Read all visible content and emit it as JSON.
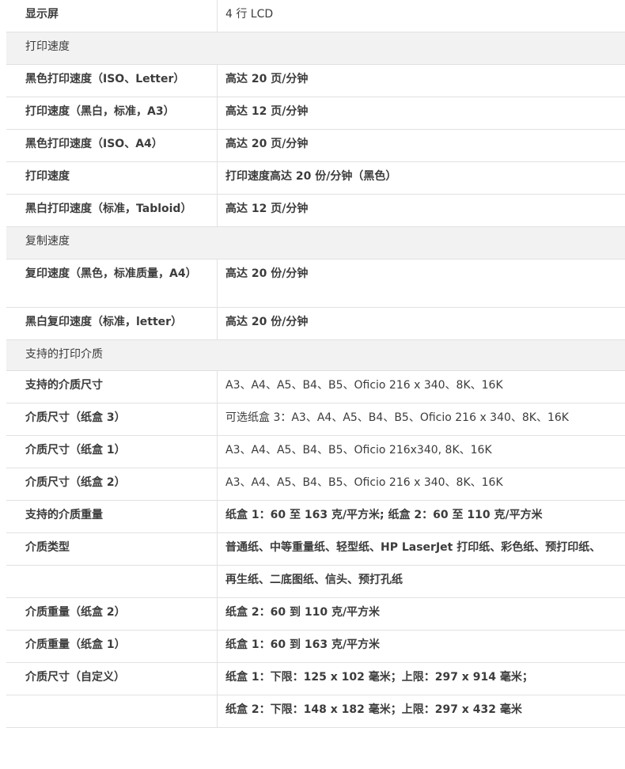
{
  "rows": [
    {
      "type": "spec",
      "label": "显示屏",
      "value": "4 行 LCD",
      "bold": false
    },
    {
      "type": "section",
      "title": "打印速度"
    },
    {
      "type": "spec",
      "label": "黑色打印速度（ISO、Letter）",
      "value": "高达 20 页/分钟",
      "bold": true
    },
    {
      "type": "spec",
      "label": "打印速度（黑白，标准，A3）",
      "value": "高达 12 页/分钟",
      "bold": true
    },
    {
      "type": "spec",
      "label": "黑色打印速度（ISO、A4）",
      "value": "高达 20 页/分钟",
      "bold": true
    },
    {
      "type": "spec",
      "label": "打印速度",
      "value": "打印速度高达 20 份/分钟（黑色）",
      "bold": true
    },
    {
      "type": "spec",
      "label": "黑白打印速度（标准，Tabloid）",
      "value": "高达 12 页/分钟",
      "bold": true
    },
    {
      "type": "section",
      "title": "复制速度"
    },
    {
      "type": "spec",
      "label": "复印速度（黑色，标准质量，A4）",
      "value": "高达 20 份/分钟",
      "bold": true,
      "tall": true
    },
    {
      "type": "spec",
      "label": "黑白复印速度（标准，letter）",
      "value": "高达 20 份/分钟",
      "bold": true
    },
    {
      "type": "section",
      "title": "支持的打印介质"
    },
    {
      "type": "spec",
      "label": "支持的介质尺寸",
      "value": "A3、A4、A5、B4、B5、Oficio 216 x 340、8K、16K",
      "bold": false
    },
    {
      "type": "spec",
      "label": "介质尺寸（纸盒 3）",
      "value": "可选纸盒 3：A3、A4、A5、B4、B5、Oficio 216 x 340、8K、16K",
      "bold": false
    },
    {
      "type": "spec",
      "label": "介质尺寸（纸盒 1）",
      "value": "A3、A4、A5、B4、B5、Oficio 216x340, 8K、16K",
      "bold": false
    },
    {
      "type": "spec",
      "label": "介质尺寸（纸盒 2）",
      "value": "A3、A4、A5、B4、B5、Oficio 216 x 340、8K、16K",
      "bold": false
    },
    {
      "type": "spec",
      "label": "支持的介质重量",
      "value": "纸盒 1：60 至 163 克/平方米; 纸盒 2：60 至 110 克/平方米",
      "bold": true
    },
    {
      "type": "spec",
      "label": "介质类型",
      "value": "普通纸、中等重量纸、轻型纸、HP LaserJet 打印纸、彩色纸、预打印纸、",
      "bold": true
    },
    {
      "type": "spec",
      "label": "",
      "value": "再生纸、二底图纸、信头、预打孔纸",
      "bold": true
    },
    {
      "type": "spec",
      "label": "介质重量（纸盒 2）",
      "value": "纸盒 2：60 到 110 克/平方米",
      "bold": true
    },
    {
      "type": "spec",
      "label": "介质重量（纸盒 1）",
      "value": "纸盒 1：60 到 163 克/平方米",
      "bold": true
    },
    {
      "type": "spec",
      "label": "介质尺寸（自定义）",
      "value": "纸盒 1：下限：125 x 102 毫米；上限：297 x 914 毫米；",
      "bold": true
    },
    {
      "type": "spec",
      "label": "",
      "value": "纸盒 2：下限：148 x 182 毫米；上限：297 x 432 毫米",
      "bold": true,
      "short": true
    }
  ]
}
